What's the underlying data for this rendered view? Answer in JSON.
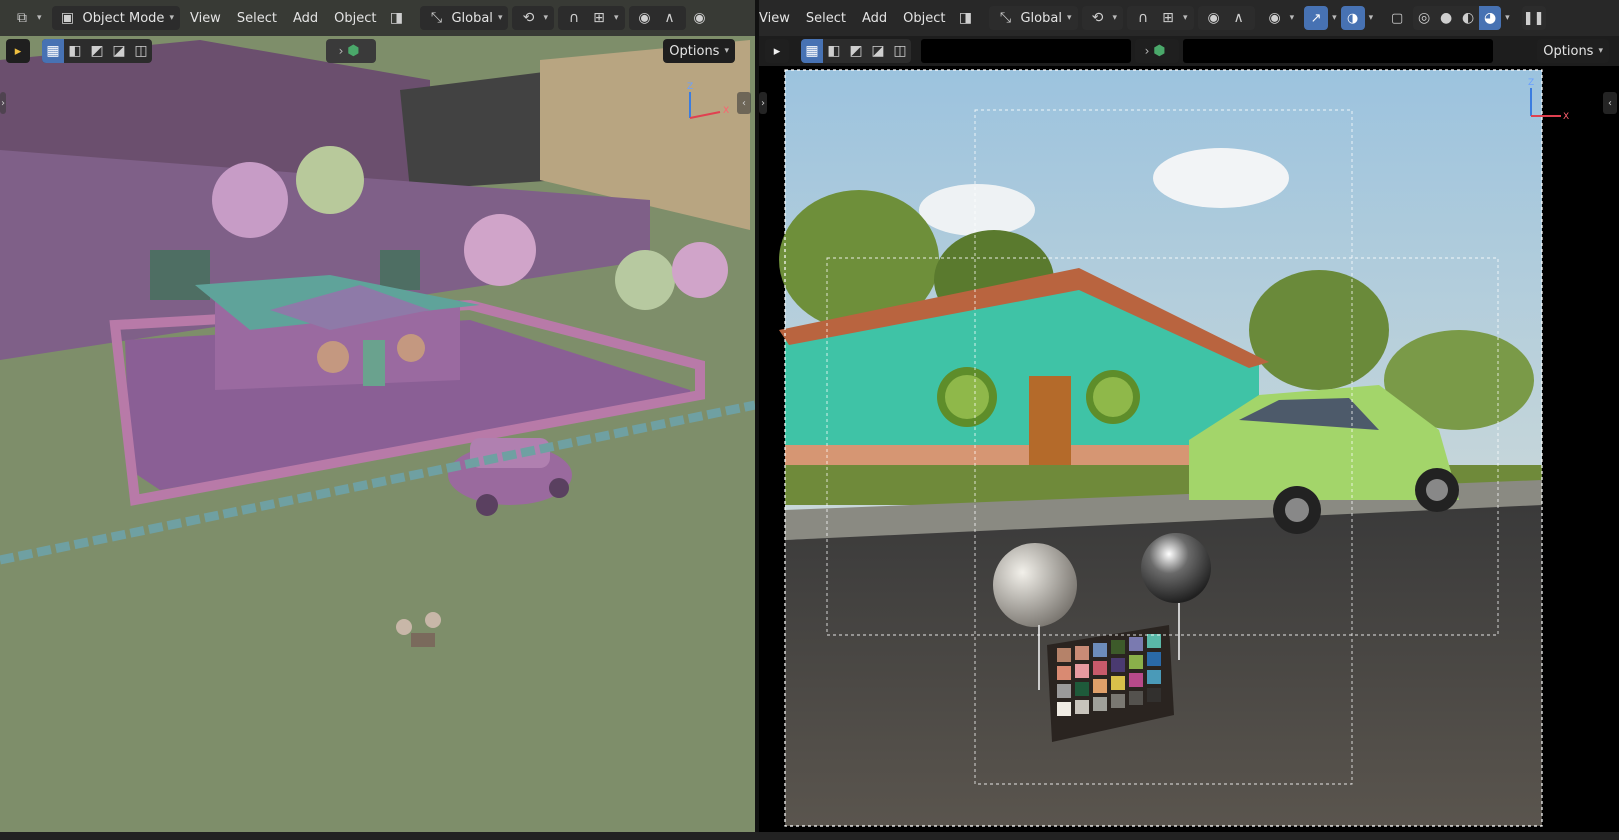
{
  "left_viewport": {
    "editor_type_icon": "viewport-editor-icon",
    "mode": "Object Mode",
    "menus": [
      "View",
      "Select",
      "Add",
      "Object"
    ],
    "orientation": "Global",
    "options_label": "Options",
    "gizmo_labels": {
      "z": "Z",
      "x": "X"
    }
  },
  "right_viewport": {
    "menus": [
      "View",
      "Select",
      "Add",
      "Object"
    ],
    "orientation": "Global",
    "options_label": "Options",
    "gizmo_labels": {
      "z": "Z",
      "x": "X"
    },
    "render_view": "rendered"
  },
  "colors": {
    "header_bg": "#282828",
    "active_blue": "#4772b3",
    "solid_ground": "#7e8e6a",
    "solid_purple": "#8e6a95",
    "render_wall": "#3fc3a6",
    "render_car": "#a3d56a",
    "render_sky": "#bcd5e6"
  },
  "icons": {
    "select_box": "select-box-icon",
    "mode_new": "mode-new-icon",
    "mode_extend": "mode-extend-icon",
    "mode_subtract": "mode-subtract-icon",
    "mode_invert": "mode-invert-icon",
    "mode_intersect": "mode-intersect-icon",
    "transform_pivot": "pivot-icon",
    "snap": "snap-icon",
    "proportional": "proportional-edit-icon",
    "visibility": "visibility-icon",
    "gizmo_toggle": "gizmo-toggle-icon",
    "overlays": "overlays-icon",
    "xray": "xray-icon",
    "shading_wire": "wireframe-shading-icon",
    "shading_solid": "solid-shading-icon",
    "shading_material": "material-shading-icon",
    "shading_rendered": "rendered-shading-icon",
    "pause": "pause-icon"
  }
}
